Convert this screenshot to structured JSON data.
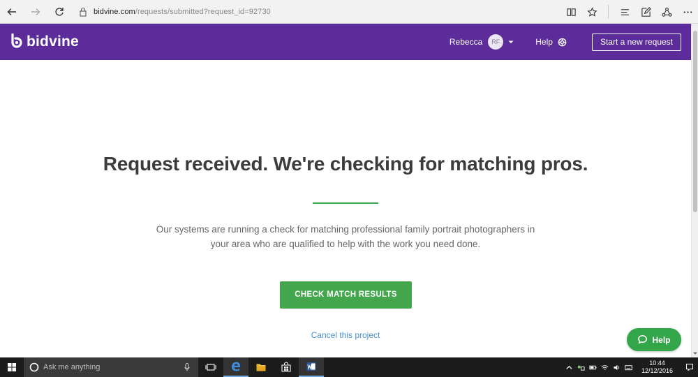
{
  "browser": {
    "url_host": "bidvine.com",
    "url_path": "/requests/submitted?request_id=92730"
  },
  "header": {
    "logo_text": "bidvine",
    "user_name": "Rebecca",
    "avatar_initials": "RF",
    "help_label": "Help",
    "start_request_label": "Start a new request"
  },
  "main": {
    "title": "Request received. We're checking for matching pros.",
    "description": "Our systems are running a check for matching professional family portrait photographers in your area who are qualified to help with the work you need done.",
    "cta_label": "CHECK MATCH RESULTS",
    "cancel_label": "Cancel this project"
  },
  "help_bubble": {
    "label": "Help"
  },
  "taskbar": {
    "search_placeholder": "Ask me anything",
    "time": "10:44",
    "date": "12/12/2016"
  },
  "colors": {
    "header_bg": "#5c2d9a",
    "accent_green": "#43a54c",
    "link_blue": "#4a90d0"
  }
}
